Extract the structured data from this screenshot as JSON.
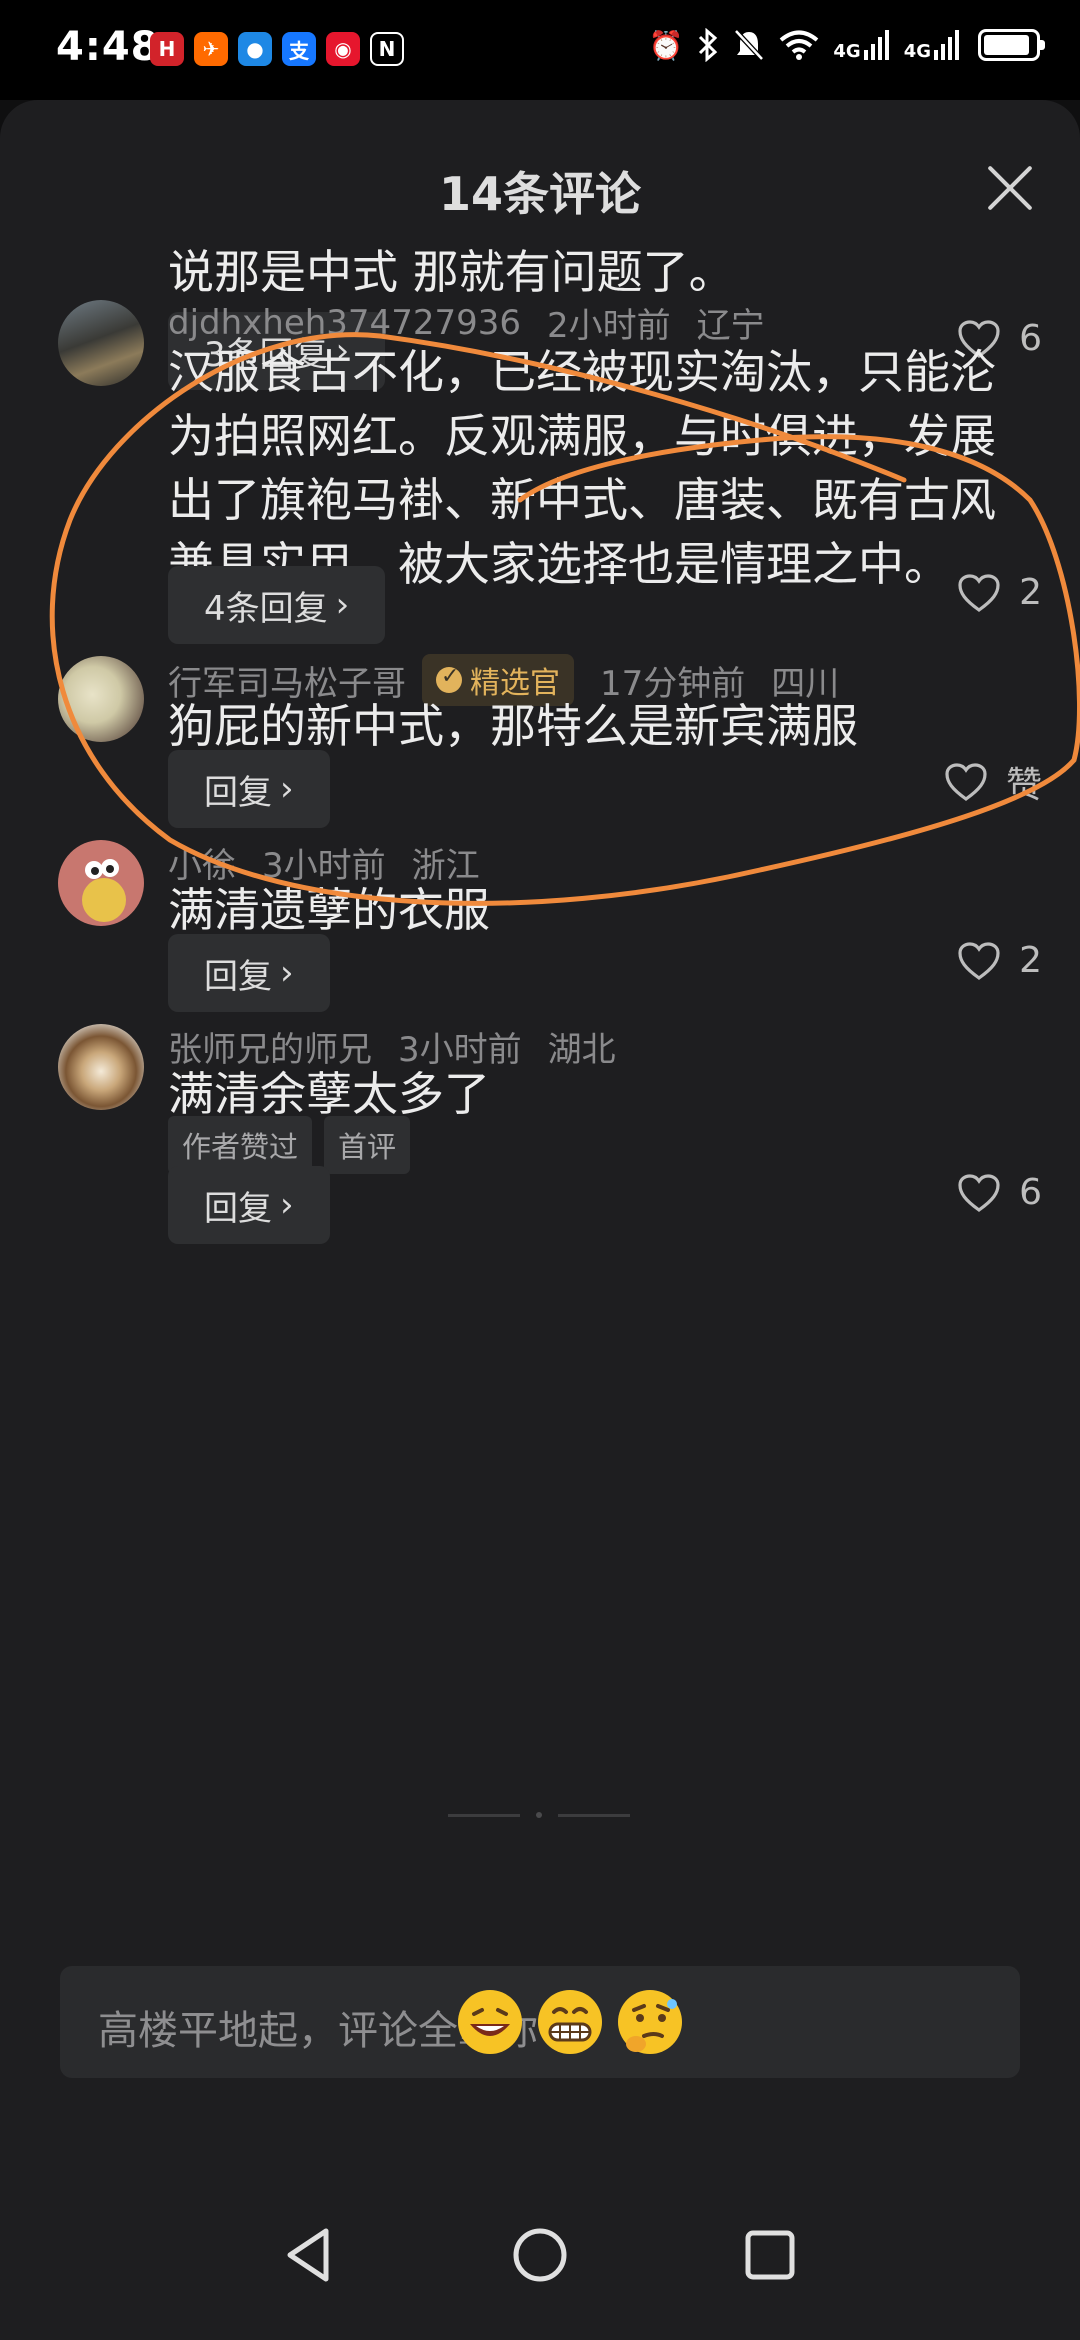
{
  "status_bar": {
    "time": "4:48",
    "apps": [
      "huawei-icon",
      "orange-app-icon",
      "message-icon",
      "alipay-icon",
      "weibo-icon",
      "nfc-icon"
    ],
    "app_glyphs": [
      "H",
      "✈",
      "●",
      "支",
      "◉",
      "N"
    ],
    "network_1": "4G",
    "network_2": "4G",
    "battery_level": 0.9
  },
  "sheet": {
    "title": "14条评论"
  },
  "partial_comment": {
    "text": "说那是中式 那就有问题了。",
    "reply_label": "3条回复",
    "likes": "6"
  },
  "comments": [
    {
      "username": "djdhxheh374727936",
      "time": "2小时前",
      "location": "辽宁",
      "text": "汉服食古不化，已经被现实淘汰，只能沦为拍照网红。反观满服，与时俱进，发展出了旗袍马褂、新中式、唐装、既有古风兼具实用，被大家选择也是情理之中。",
      "reply_label": "4条回复",
      "likes": "2"
    },
    {
      "username": "行军司马松子哥",
      "badge": "精选官",
      "time": "17分钟前",
      "location": "四川",
      "text": "狗屁的新中式，那特么是新宾满服",
      "reply_label": "回复",
      "likes": "赞"
    },
    {
      "username": "小徐",
      "time": "3小时前",
      "location": "浙江",
      "text": "满清遗孽的衣服",
      "reply_label": "回复",
      "likes": "2"
    },
    {
      "username": "张师兄的师兄",
      "time": "3小时前",
      "location": "湖北",
      "text": "满清余孽太多了",
      "tags": [
        "作者赞过",
        "首评"
      ],
      "reply_label": "回复",
      "likes": "6"
    }
  ],
  "input": {
    "placeholder": "高楼平地起，评论全靠你",
    "emojis": [
      "laughing-emoji",
      "grinning-emoji",
      "thinking-emoji"
    ]
  },
  "colors": {
    "annotation": "#f08a3c",
    "badge_text": "#e2b35c",
    "sheet_bg": "#1e1e20"
  }
}
